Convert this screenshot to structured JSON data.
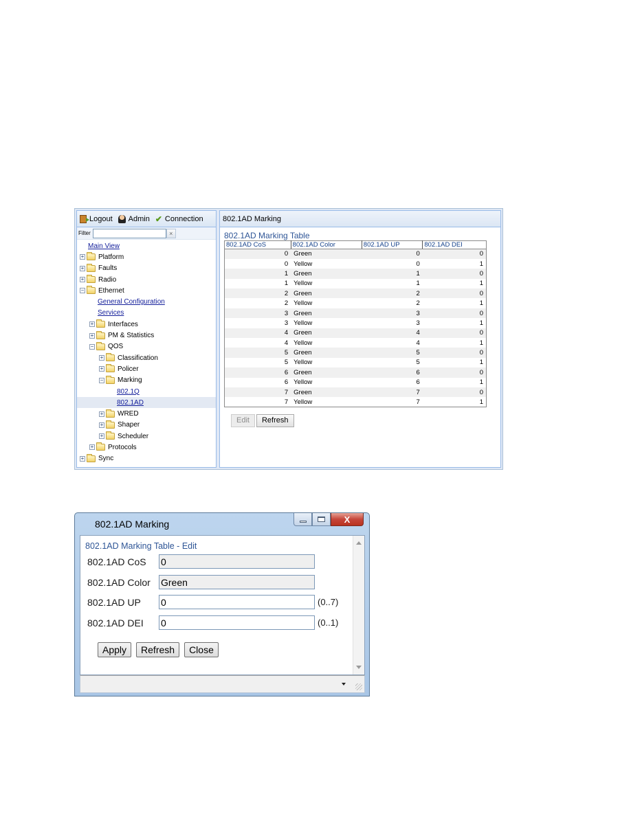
{
  "app": {
    "toolbar": {
      "logout_label": "Logout",
      "admin_label": "Admin",
      "connection_label": "Connection"
    },
    "filter": {
      "label": "Filter",
      "value": "",
      "clear_glyph": "×"
    },
    "tree": [
      {
        "label": "Main View",
        "level": 0,
        "type": "link"
      },
      {
        "label": "Platform",
        "level": 0,
        "type": "folder",
        "expanded": false
      },
      {
        "label": "Faults",
        "level": 0,
        "type": "folder",
        "expanded": false
      },
      {
        "label": "Radio",
        "level": 0,
        "type": "folder",
        "expanded": false
      },
      {
        "label": "Ethernet",
        "level": 0,
        "type": "folder",
        "expanded": true
      },
      {
        "label": "General Configuration",
        "level": 1,
        "type": "link"
      },
      {
        "label": "Services",
        "level": 1,
        "type": "link"
      },
      {
        "label": "Interfaces",
        "level": 1,
        "type": "folder",
        "expanded": false
      },
      {
        "label": "PM & Statistics",
        "level": 1,
        "type": "folder",
        "expanded": false
      },
      {
        "label": "QOS",
        "level": 1,
        "type": "folder",
        "expanded": true
      },
      {
        "label": "Classification",
        "level": 2,
        "type": "folder",
        "expanded": false
      },
      {
        "label": "Policer",
        "level": 2,
        "type": "folder",
        "expanded": false
      },
      {
        "label": "Marking",
        "level": 2,
        "type": "folder",
        "expanded": true
      },
      {
        "label": "802.1Q",
        "level": 3,
        "type": "link"
      },
      {
        "label": "802.1AD",
        "level": 3,
        "type": "link",
        "selected": true
      },
      {
        "label": "WRED",
        "level": 2,
        "type": "folder",
        "expanded": false
      },
      {
        "label": "Shaper",
        "level": 2,
        "type": "folder",
        "expanded": false
      },
      {
        "label": "Scheduler",
        "level": 2,
        "type": "folder",
        "expanded": false
      },
      {
        "label": "Protocols",
        "level": 1,
        "type": "folder",
        "expanded": false
      },
      {
        "label": "Sync",
        "level": 0,
        "type": "folder",
        "expanded": false
      }
    ],
    "panel": {
      "title": "802.1AD Marking",
      "table_title": "802.1AD Marking Table",
      "columns": [
        "802.1AD CoS",
        "802.1AD Color",
        "802.1AD UP",
        "802.1AD DEI"
      ],
      "rows": [
        [
          "0",
          "Green",
          "0",
          "0"
        ],
        [
          "0",
          "Yellow",
          "0",
          "1"
        ],
        [
          "1",
          "Green",
          "1",
          "0"
        ],
        [
          "1",
          "Yellow",
          "1",
          "1"
        ],
        [
          "2",
          "Green",
          "2",
          "0"
        ],
        [
          "2",
          "Yellow",
          "2",
          "1"
        ],
        [
          "3",
          "Green",
          "3",
          "0"
        ],
        [
          "3",
          "Yellow",
          "3",
          "1"
        ],
        [
          "4",
          "Green",
          "4",
          "0"
        ],
        [
          "4",
          "Yellow",
          "4",
          "1"
        ],
        [
          "5",
          "Green",
          "5",
          "0"
        ],
        [
          "5",
          "Yellow",
          "5",
          "1"
        ],
        [
          "6",
          "Green",
          "6",
          "0"
        ],
        [
          "6",
          "Yellow",
          "6",
          "1"
        ],
        [
          "7",
          "Green",
          "7",
          "0"
        ],
        [
          "7",
          "Yellow",
          "7",
          "1"
        ]
      ],
      "buttons": {
        "edit": "Edit",
        "refresh": "Refresh"
      }
    }
  },
  "dialog": {
    "window_title": "802.1AD Marking",
    "close_glyph": "X",
    "heading": "802.1AD Marking Table - Edit",
    "fields": [
      {
        "label": "802.1AD CoS",
        "value": "0",
        "readonly": true,
        "range": ""
      },
      {
        "label": "802.1AD Color",
        "value": "Green",
        "readonly": true,
        "range": ""
      },
      {
        "label": "802.1AD UP",
        "value": "0",
        "readonly": false,
        "range": "(0..7)"
      },
      {
        "label": "802.1AD DEI",
        "value": "0",
        "readonly": false,
        "range": "(0..1)"
      }
    ],
    "buttons": {
      "apply": "Apply",
      "refresh": "Refresh",
      "close": "Close"
    }
  }
}
